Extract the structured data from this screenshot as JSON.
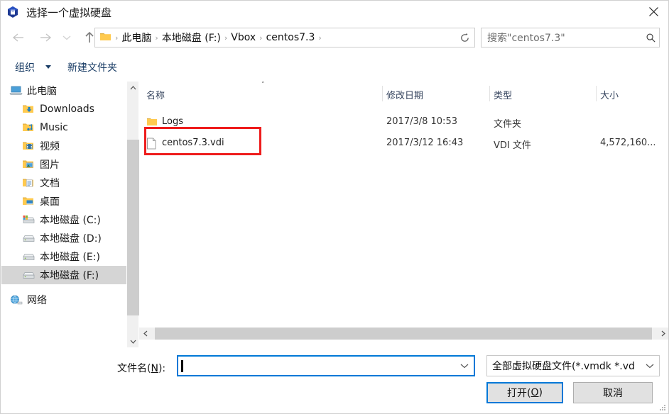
{
  "window": {
    "title": "选择一个虚拟硬盘",
    "title_icon": "virtualbox-cube-icon",
    "close_label": "✕"
  },
  "nav": {
    "back_icon": "arrow-left-icon",
    "forward_icon": "arrow-right-icon",
    "recent_icon": "chevron-down-icon",
    "up_icon": "arrow-up-icon",
    "refresh_icon": "refresh-icon",
    "address": {
      "folder_icon": "folder-icon",
      "crumbs": [
        {
          "label": "此电脑"
        },
        {
          "label": "本地磁盘 (F:)"
        },
        {
          "label": "Vbox"
        },
        {
          "label": "centos7.3"
        }
      ],
      "separator": "›",
      "dropdown_icon": "chevron-down-icon"
    },
    "search": {
      "placeholder": "搜索\"centos7.3\"",
      "icon": "search-icon"
    }
  },
  "toolbar": {
    "organize_label": "组织",
    "new_folder_label": "新建文件夹",
    "view_icon": "view-list-icon",
    "view_dropdown_icon": "chevron-down-icon",
    "preview_pane_icon": "preview-pane-icon",
    "help_icon": "help-icon"
  },
  "sidebar": {
    "items": [
      {
        "label": "此电脑",
        "icon": "computer-icon",
        "indent": 0,
        "selected": false
      },
      {
        "label": "Downloads",
        "icon": "folder-downloads-icon",
        "indent": 1,
        "selected": false
      },
      {
        "label": "Music",
        "icon": "folder-music-icon",
        "indent": 1,
        "selected": false
      },
      {
        "label": "视频",
        "icon": "folder-videos-icon",
        "indent": 1,
        "selected": false
      },
      {
        "label": "图片",
        "icon": "folder-pictures-icon",
        "indent": 1,
        "selected": false
      },
      {
        "label": "文档",
        "icon": "folder-documents-icon",
        "indent": 1,
        "selected": false
      },
      {
        "label": "桌面",
        "icon": "folder-desktop-icon",
        "indent": 1,
        "selected": false
      },
      {
        "label": "本地磁盘 (C:)",
        "icon": "system-drive-icon",
        "indent": 1,
        "selected": false
      },
      {
        "label": "本地磁盘 (D:)",
        "icon": "drive-icon",
        "indent": 1,
        "selected": false
      },
      {
        "label": "本地磁盘 (E:)",
        "icon": "drive-icon",
        "indent": 1,
        "selected": false
      },
      {
        "label": "本地磁盘 (F:)",
        "icon": "drive-icon",
        "indent": 1,
        "selected": true
      },
      {
        "label": "网络",
        "icon": "network-icon",
        "indent": 0,
        "selected": false
      }
    ],
    "scroll_up_icon": "chevron-up-icon",
    "scroll_down_icon": "chevron-down-icon"
  },
  "filelist": {
    "columns": [
      {
        "label": "名称",
        "sorted": "asc"
      },
      {
        "label": "修改日期",
        "sorted": ""
      },
      {
        "label": "类型",
        "sorted": ""
      },
      {
        "label": "大小",
        "sorted": ""
      }
    ],
    "sort_caret": "˄",
    "rows": [
      {
        "name": "Logs",
        "icon": "folder-icon",
        "date": "2017/3/8 10:53",
        "type": "文件夹",
        "size": ""
      },
      {
        "name": "centos7.3.vdi",
        "icon": "file-icon",
        "date": "2017/3/12 16:43",
        "type": "VDI 文件",
        "size": "4,572,160..."
      }
    ],
    "annotation": {
      "color": "#ee1c1c",
      "target": "centos7.3.vdi"
    },
    "hscroll_left_icon": "chevron-left-icon",
    "hscroll_right_icon": "chevron-right-icon"
  },
  "bottom": {
    "filename_label_pre": "文件名(",
    "filename_label_key": "N",
    "filename_label_post": "):",
    "filename_value": "",
    "filename_dropdown_icon": "chevron-down-icon",
    "filter_value": "全部虚拟硬盘文件(*.vmdk *.vd",
    "filter_dropdown_icon": "chevron-down-icon",
    "open_pre": "打开(",
    "open_key": "O",
    "open_post": ")",
    "cancel_label": "取消"
  },
  "colors": {
    "accent": "#0078d7",
    "annotation": "#ee1c1c",
    "toolbar_text": "#1a3d66",
    "selected_row": "#d5d5d5"
  }
}
